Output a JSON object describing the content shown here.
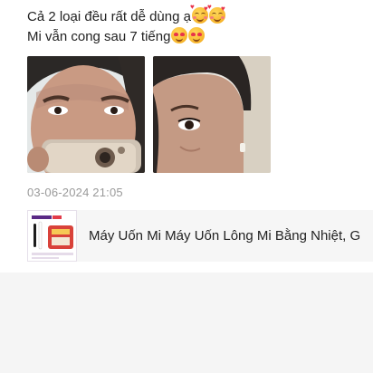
{
  "review": {
    "line1": "Cả 2 loại đều rất dễ dùng ạ",
    "line1_emojis": [
      "smiling-face-with-hearts",
      "smiling-face-with-hearts"
    ],
    "line2": "Mi vẫn cong sau 7 tiếng",
    "line2_emojis": [
      "heart-eyes",
      "heart-eyes"
    ],
    "photos": [
      "review-photo-1",
      "review-photo-2"
    ],
    "date": "03-06-2024 21:05"
  },
  "product": {
    "name": "Máy Uốn Mi Máy Uốn Lông Mi Bằng Nhiệt, G",
    "thumb_brand": "MÁY UỐN MI CARE"
  },
  "colors": {
    "text": "#222222",
    "muted": "#9a9a9a",
    "product_bg": "#f6f6f6",
    "page_bg": "#f5f5f5"
  }
}
